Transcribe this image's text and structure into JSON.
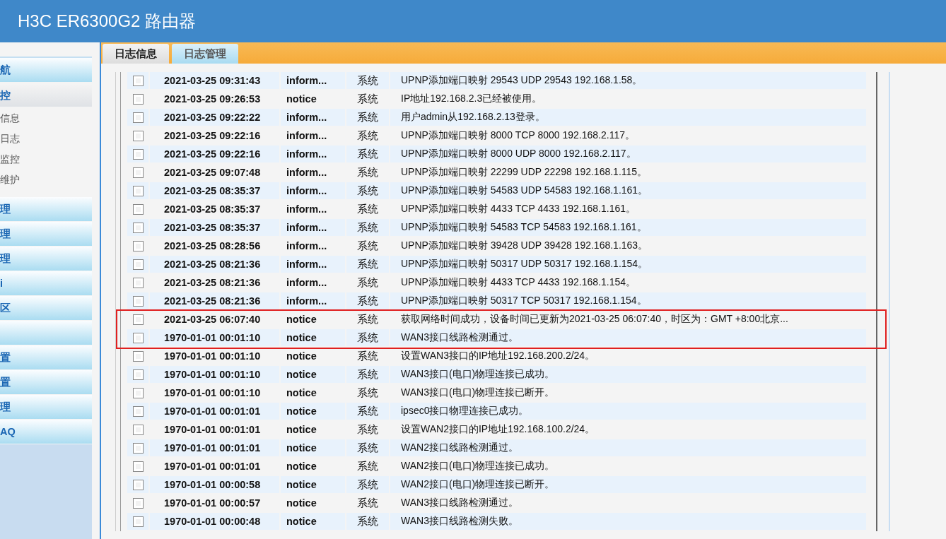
{
  "header": {
    "title": "H3C ER6300G2 路由器"
  },
  "sidebar": {
    "items": [
      {
        "kind": "nav",
        "label": "航"
      },
      {
        "kind": "section",
        "label": "控"
      },
      {
        "kind": "sub",
        "label": "信息"
      },
      {
        "kind": "sub",
        "label": "日志"
      },
      {
        "kind": "sub",
        "label": "监控"
      },
      {
        "kind": "sub",
        "label": "维护"
      },
      {
        "kind": "nav",
        "label": "理"
      },
      {
        "kind": "nav",
        "label": "理"
      },
      {
        "kind": "nav",
        "label": "理"
      },
      {
        "kind": "nav",
        "label": "i"
      },
      {
        "kind": "nav",
        "label": "区"
      },
      {
        "kind": "nav"
      },
      {
        "kind": "nav",
        "label": "置"
      },
      {
        "kind": "nav",
        "label": "置"
      },
      {
        "kind": "nav",
        "label": "理"
      },
      {
        "kind": "nav",
        "label": "AQ"
      }
    ]
  },
  "tabs": [
    {
      "label": "日志信息",
      "selected": true
    },
    {
      "label": "日志管理",
      "selected": false
    }
  ],
  "log_table": {
    "rows": [
      {
        "checked": false,
        "time": "2021-03-25 09:31:43",
        "level": "inform...",
        "source": "系统",
        "message": "UPNP添加端口映射 29543 UDP 29543 192.168.1.58。",
        "highlighted": false
      },
      {
        "checked": false,
        "time": "2021-03-25 09:26:53",
        "level": "notice",
        "source": "系统",
        "message": "IP地址192.168.2.3已经被使用。",
        "highlighted": false
      },
      {
        "checked": false,
        "time": "2021-03-25 09:22:22",
        "level": "inform...",
        "source": "系统",
        "message": "用户admin从192.168.2.13登录。",
        "highlighted": false
      },
      {
        "checked": false,
        "time": "2021-03-25 09:22:16",
        "level": "inform...",
        "source": "系统",
        "message": "UPNP添加端口映射 8000 TCP 8000 192.168.2.117。",
        "highlighted": false
      },
      {
        "checked": false,
        "time": "2021-03-25 09:22:16",
        "level": "inform...",
        "source": "系统",
        "message": "UPNP添加端口映射 8000 UDP 8000 192.168.2.117。",
        "highlighted": false
      },
      {
        "checked": false,
        "time": "2021-03-25 09:07:48",
        "level": "inform...",
        "source": "系统",
        "message": "UPNP添加端口映射 22299 UDP 22298 192.168.1.115。",
        "highlighted": false
      },
      {
        "checked": false,
        "time": "2021-03-25 08:35:37",
        "level": "inform...",
        "source": "系统",
        "message": "UPNP添加端口映射 54583 UDP 54583 192.168.1.161。",
        "highlighted": false
      },
      {
        "checked": false,
        "time": "2021-03-25 08:35:37",
        "level": "inform...",
        "source": "系统",
        "message": "UPNP添加端口映射 4433 TCP 4433 192.168.1.161。",
        "highlighted": false
      },
      {
        "checked": false,
        "time": "2021-03-25 08:35:37",
        "level": "inform...",
        "source": "系统",
        "message": "UPNP添加端口映射 54583 TCP 54583 192.168.1.161。",
        "highlighted": false
      },
      {
        "checked": false,
        "time": "2021-03-25 08:28:56",
        "level": "inform...",
        "source": "系统",
        "message": "UPNP添加端口映射 39428 UDP 39428 192.168.1.163。",
        "highlighted": false
      },
      {
        "checked": false,
        "time": "2021-03-25 08:21:36",
        "level": "inform...",
        "source": "系统",
        "message": "UPNP添加端口映射 50317 UDP 50317 192.168.1.154。",
        "highlighted": false
      },
      {
        "checked": false,
        "time": "2021-03-25 08:21:36",
        "level": "inform...",
        "source": "系统",
        "message": "UPNP添加端口映射 4433 TCP 4433 192.168.1.154。",
        "highlighted": false
      },
      {
        "checked": false,
        "time": "2021-03-25 08:21:36",
        "level": "inform...",
        "source": "系统",
        "message": "UPNP添加端口映射 50317 TCP 50317 192.168.1.154。",
        "highlighted": false
      },
      {
        "checked": false,
        "time": "2021-03-25 06:07:40",
        "level": "notice",
        "source": "系统",
        "message": "获取网络时间成功，设备时间已更新为2021-03-25 06:07:40，时区为：GMT +8:00北京...",
        "highlighted": true
      },
      {
        "checked": false,
        "time": "1970-01-01 00:01:10",
        "level": "notice",
        "source": "系统",
        "message": "WAN3接口线路检测通过。",
        "highlighted": true
      },
      {
        "checked": false,
        "time": "1970-01-01 00:01:10",
        "level": "notice",
        "source": "系统",
        "message": "设置WAN3接口的IP地址192.168.200.2/24。",
        "highlighted": false
      },
      {
        "checked": false,
        "time": "1970-01-01 00:01:10",
        "level": "notice",
        "source": "系统",
        "message": "WAN3接口(电口)物理连接已成功。",
        "highlighted": false
      },
      {
        "checked": false,
        "time": "1970-01-01 00:01:10",
        "level": "notice",
        "source": "系统",
        "message": "WAN3接口(电口)物理连接已断开。",
        "highlighted": false
      },
      {
        "checked": false,
        "time": "1970-01-01 00:01:01",
        "level": "notice",
        "source": "系统",
        "message": "ipsec0接口物理连接已成功。",
        "highlighted": false
      },
      {
        "checked": false,
        "time": "1970-01-01 00:01:01",
        "level": "notice",
        "source": "系统",
        "message": "设置WAN2接口的IP地址192.168.100.2/24。",
        "highlighted": false
      },
      {
        "checked": false,
        "time": "1970-01-01 00:01:01",
        "level": "notice",
        "source": "系统",
        "message": "WAN2接口线路检测通过。",
        "highlighted": false
      },
      {
        "checked": false,
        "time": "1970-01-01 00:01:01",
        "level": "notice",
        "source": "系统",
        "message": "WAN2接口(电口)物理连接已成功。",
        "highlighted": false
      },
      {
        "checked": false,
        "time": "1970-01-01 00:00:58",
        "level": "notice",
        "source": "系统",
        "message": "WAN2接口(电口)物理连接已断开。",
        "highlighted": false
      },
      {
        "checked": false,
        "time": "1970-01-01 00:00:57",
        "level": "notice",
        "source": "系统",
        "message": "WAN3接口线路检测通过。",
        "highlighted": false
      },
      {
        "checked": false,
        "time": "1970-01-01 00:00:48",
        "level": "notice",
        "source": "系统",
        "message": "WAN3接口线路检测失败。",
        "highlighted": false
      }
    ]
  }
}
